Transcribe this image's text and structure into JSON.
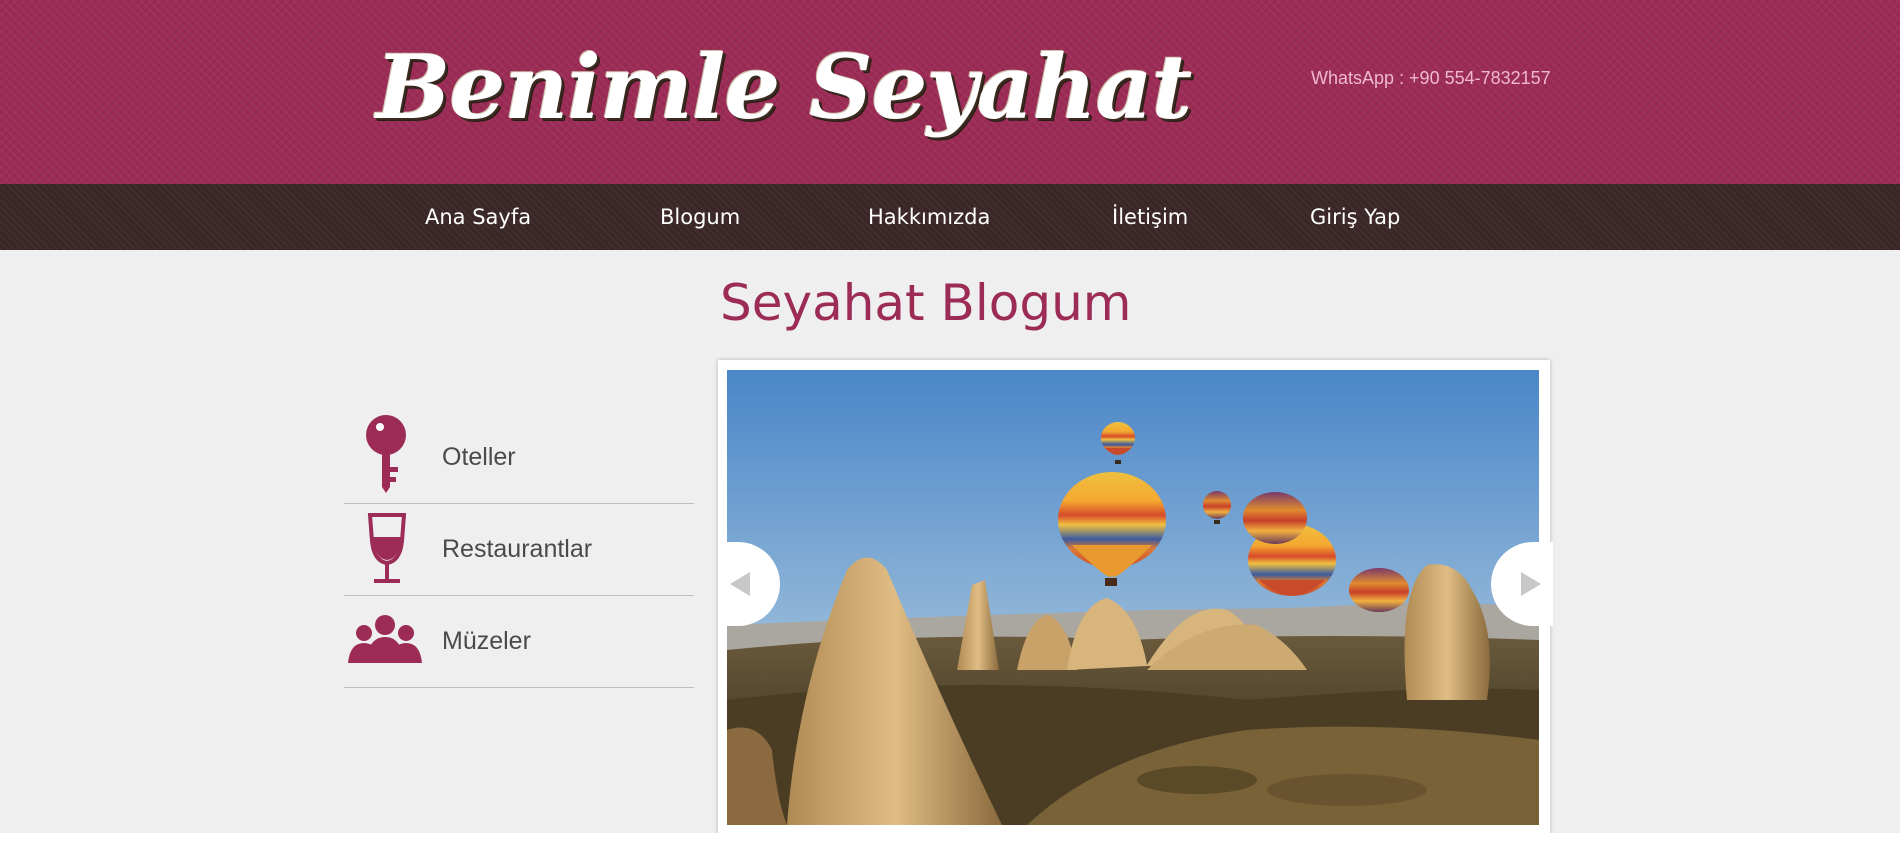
{
  "header": {
    "logo_text": "Benimle Seyahat",
    "whatsapp": "WhatsApp : +90 554-7832157"
  },
  "nav": {
    "items": [
      {
        "label": "Ana Sayfa"
      },
      {
        "label": "Blogum"
      },
      {
        "label": "Hakkımızda"
      },
      {
        "label": "İletişim"
      },
      {
        "label": "Giriş Yap"
      }
    ]
  },
  "main": {
    "title": "Seyahat Blogum"
  },
  "sidebar": {
    "categories": [
      {
        "label": "Oteller",
        "icon": "key-icon"
      },
      {
        "label": "Restaurantlar",
        "icon": "wine-glass-icon"
      },
      {
        "label": "Müzeler",
        "icon": "people-icon"
      }
    ]
  },
  "slider": {
    "image": "cappadocia-hot-air-balloons",
    "prev_icon": "chevron-left-icon",
    "next_icon": "chevron-right-icon"
  },
  "colors": {
    "brand": "#9c2c56",
    "nav_bg": "#3a2626",
    "page_bg": "#efefef",
    "whatsapp_text": "#f0b8d0"
  }
}
